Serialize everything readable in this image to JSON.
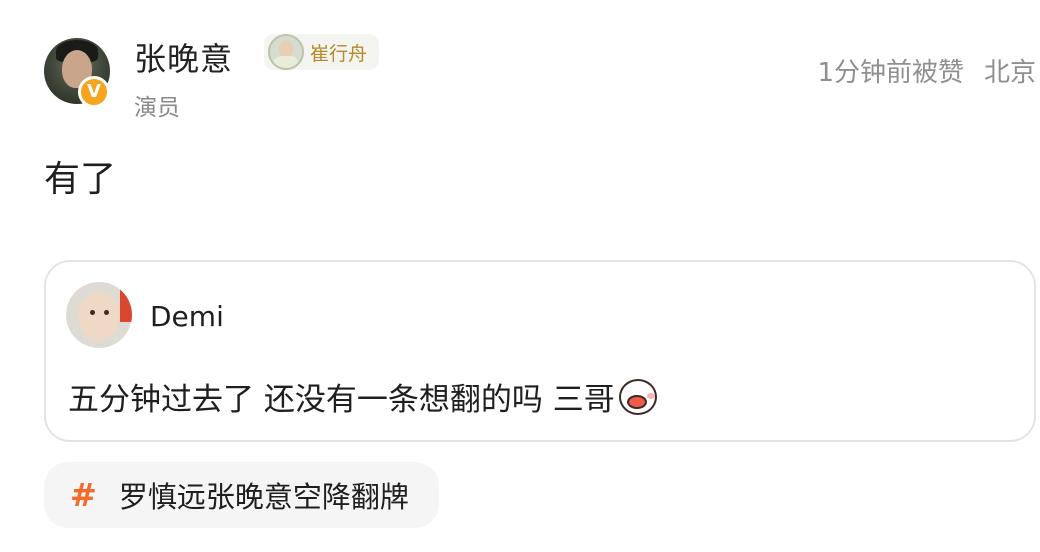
{
  "comment": {
    "username": "张晚意",
    "fan_tag": "崔行舟",
    "role": "演员",
    "liked_time": "1分钟前被赞",
    "location": "北京",
    "text": "有了"
  },
  "quote": {
    "username": "Demi",
    "text": "五分钟过去了 还没有一条想翻的吗 三哥"
  },
  "topic": {
    "label": "罗慎远张晚意空降翻牌"
  },
  "colors": {
    "verified_badge": "#f7a51e",
    "topic_hash": "#f36a2b",
    "fan_tag_text": "#b88a2a",
    "meta_text": "#8f8f8f"
  },
  "icons": {
    "verified": "verified-badge-icon",
    "emoji": "duck-emoji-icon",
    "topic": "hashtag-icon"
  }
}
